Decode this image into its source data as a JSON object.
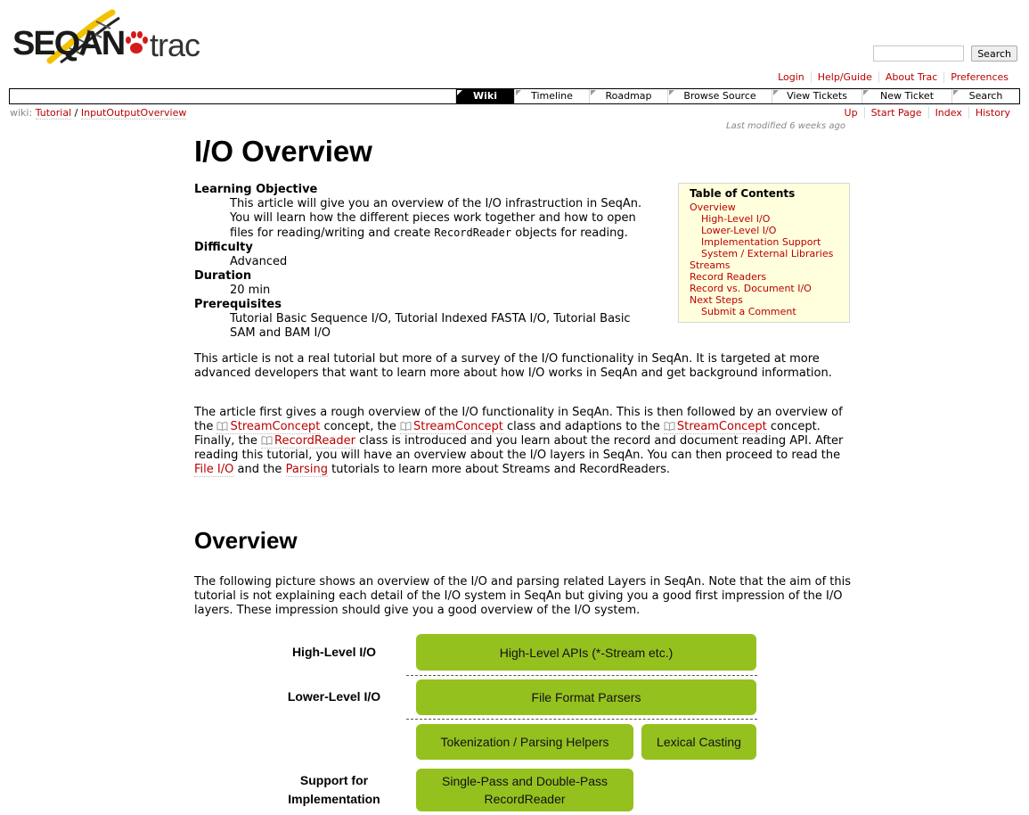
{
  "logo": {
    "seq": "SEQ",
    "an": "AN",
    "trac": "trac"
  },
  "search": {
    "placeholder": "",
    "button": "Search"
  },
  "metanav": [
    "Login",
    "Help/Guide",
    "About Trac",
    "Preferences"
  ],
  "mainnav": [
    {
      "label": "Wiki",
      "active": true
    },
    {
      "label": "Timeline"
    },
    {
      "label": "Roadmap"
    },
    {
      "label": "Browse Source"
    },
    {
      "label": "View Tickets"
    },
    {
      "label": "New Ticket"
    },
    {
      "label": "Search"
    }
  ],
  "breadcrumb": {
    "prefix": "wiki:",
    "path1": "Tutorial",
    "sep": "/",
    "path2": "InputOutputOverview"
  },
  "ctxnav": [
    "Up",
    "Start Page",
    "Index",
    "History"
  ],
  "last_modified": {
    "label": "Last modified",
    "age": "6 weeks ago"
  },
  "page": {
    "title": "I/O Overview",
    "meta": {
      "objective_label": "Learning Objective",
      "objective_pre": "This article will give you an overview of the I/O infrastruction in SeqAn. You will learn how the different pieces work together and how to open files for reading/writing and create",
      "objective_code": "RecordReader",
      "objective_post": "objects for reading.",
      "difficulty_label": "Difficulty",
      "difficulty": "Advanced",
      "duration_label": "Duration",
      "duration": "20 min",
      "prereq_label": "Prerequisites",
      "prereq": "Tutorial Basic Sequence I/O, Tutorial Indexed FASTA I/O, Tutorial Basic SAM and BAM I/O"
    },
    "intro": "This article is not a real tutorial but more of a survey of the I/O functionality in SeqAn. It is targeted at more advanced developers that want to learn more about how I/O works in SeqAn and get background information.",
    "para2": {
      "t1": "The article first gives a rough overview of the I/O functionality in SeqAn. This is then followed by an overview of the",
      "l1": "StreamConcept",
      "t2": "concept, the",
      "l2": "StreamConcept",
      "t3": "class and adaptions to the",
      "l3": "StreamConcept",
      "t4": "concept. Finally, the",
      "l4": "RecordReader",
      "t5": "class is introduced and you learn about the record and document reading API. After reading this tutorial, you will have an overview about the I/O layers in SeqAn. You can then proceed to read the",
      "l5": "File I/O",
      "t6": "and the",
      "l6": "Parsing",
      "t7": "tutorials to learn more about Streams and RecordReaders."
    },
    "overview_heading": "Overview",
    "overview_para": "The following picture shows an overview of the I/O and parsing related Layers in SeqAn. Note that the aim of this tutorial is not explaining each detail of the I/O system in SeqAn but giving you a good first impression of the I/O layers. These impression should give you a good overview of the I/O system."
  },
  "toc": {
    "title": "Table of Contents",
    "items": [
      {
        "label": "Overview",
        "level": 1
      },
      {
        "label": "High-Level I/O",
        "level": 2
      },
      {
        "label": "Lower-Level I/O",
        "level": 2
      },
      {
        "label": "Implementation Support",
        "level": 2
      },
      {
        "label": "System / External Libraries",
        "level": 2
      },
      {
        "label": "Streams",
        "level": 1
      },
      {
        "label": "Record Readers",
        "level": 1
      },
      {
        "label": "Record vs. Document I/O",
        "level": 1
      },
      {
        "label": "Next Steps",
        "level": 1
      },
      {
        "label": "Submit a Comment",
        "level": 2
      }
    ]
  },
  "diagram": {
    "labels": {
      "high": "High-Level I/O",
      "lower": "Lower-Level I/O",
      "support1": "Support for",
      "support2": "Implementation"
    },
    "boxes": {
      "high_api": "High-Level APIs (*-Stream etc.)",
      "parsers": "File Format Parsers",
      "tokenization": "Tokenization / Parsing Helpers",
      "lexical": "Lexical Casting",
      "recordreader1": "Single-Pass and Double-Pass",
      "recordreader2": "RecordReader"
    },
    "box_color": "#95c11f"
  },
  "colors": {
    "link": "#bb0000",
    "toc_bg": "#ffffdd",
    "nav_active": "#000000"
  }
}
